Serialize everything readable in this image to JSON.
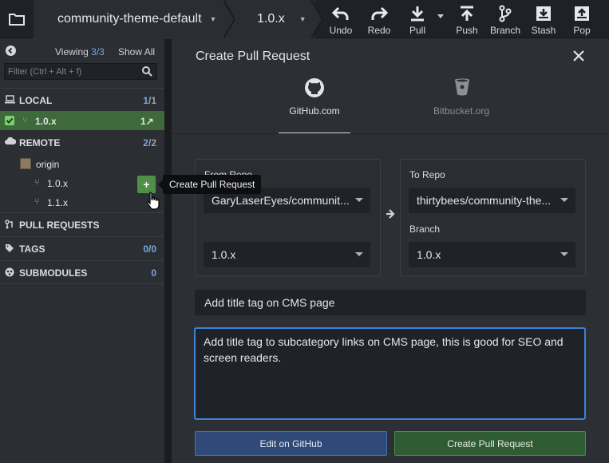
{
  "toolbar": {
    "repo_name": "community-theme-default",
    "branch_name": "1.0.x",
    "buttons": {
      "undo": "Undo",
      "redo": "Redo",
      "pull": "Pull",
      "push": "Push",
      "branch": "Branch",
      "stash": "Stash",
      "pop": "Pop"
    }
  },
  "sidebar": {
    "viewing_label": "Viewing",
    "viewing_count": "3/3",
    "show_all": "Show All",
    "filter_placeholder": "Filter (Ctrl + Alt + f)",
    "local": {
      "label": "LOCAL",
      "count_a": "1",
      "count_b": "/1"
    },
    "local_branch": {
      "name": "1.0.x",
      "status": "1↗"
    },
    "remote": {
      "label": "REMOTE",
      "count_a": "2",
      "count_b": "/2"
    },
    "remote_name": "origin",
    "remote_branches": [
      "1.0.x",
      "1.1.x"
    ],
    "pull_requests": {
      "label": "PULL REQUESTS",
      "add": "+"
    },
    "tags": {
      "label": "TAGS",
      "count": "0/0"
    },
    "submodules": {
      "label": "SUBMODULES",
      "count": "0"
    },
    "tooltip": "Create Pull Request"
  },
  "dialog": {
    "title": "Create Pull Request",
    "providers": {
      "github": "GitHub.com",
      "bitbucket": "Bitbucket.org"
    },
    "from_repo_label": "From Repo",
    "from_repo_value": "GaryLaserEyes/communit...",
    "from_branch_value": "1.0.x",
    "to_repo_label": "To Repo",
    "to_repo_value": "thirtybees/community-the...",
    "to_branch_label": "Branch",
    "to_branch_value": "1.0.x",
    "pr_title": "Add title tag on CMS page",
    "pr_description": "Add title tag to subcategory links on CMS page, this is good for SEO and screen readers.",
    "edit_button": "Edit on GitHub",
    "create_button": "Create Pull Request"
  },
  "colors": {
    "accent_blue": "#3d82d8",
    "active_green": "#3e6a3b",
    "create_green": "#2f5c33",
    "edit_blue": "#2f4a79"
  }
}
